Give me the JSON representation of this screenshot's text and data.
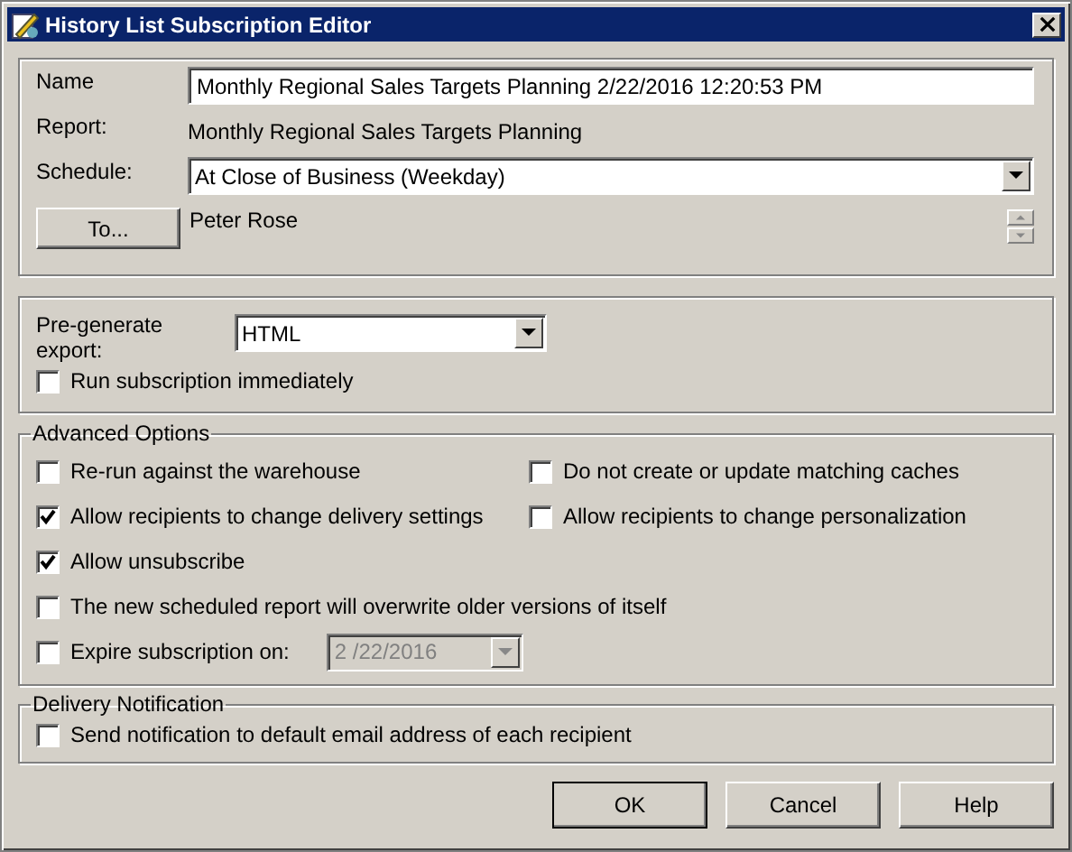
{
  "window": {
    "title": "History List Subscription Editor"
  },
  "general": {
    "name_label": "Name",
    "name_value": "Monthly Regional Sales Targets Planning 2/22/2016 12:20:53 PM",
    "report_label": "Report:",
    "report_value": "Monthly Regional Sales Targets Planning",
    "schedule_label": "Schedule:",
    "schedule_value": "At Close of Business (Weekday)",
    "to_button": "To...",
    "recipients": "Peter Rose"
  },
  "export": {
    "label": "Pre-generate export:",
    "value": "HTML",
    "run_immediately": {
      "label": "Run subscription immediately",
      "checked": false
    }
  },
  "advanced_options": {
    "title": "Advanced Options",
    "options": [
      {
        "kind": "checkbox",
        "label": "Re-run against the warehouse",
        "checked": false
      },
      {
        "kind": "checkbox",
        "label": "Do not create or update matching caches",
        "checked": false
      },
      {
        "kind": "checkbox",
        "label": "Allow recipients to change delivery settings",
        "checked": true
      },
      {
        "kind": "checkbox",
        "label": "Allow recipients to change personalization",
        "checked": false
      },
      {
        "kind": "wide",
        "label": "Allow unsubscribe",
        "checked": true
      },
      {
        "kind": "wide",
        "label": "The new scheduled report will overwrite older versions of itself",
        "checked": false
      },
      {
        "kind": "date",
        "label": "Expire subscription on:",
        "checked": false,
        "date": "2 /22/2016",
        "disabled": true
      }
    ]
  },
  "delivery_notification": {
    "title": "Delivery Notification",
    "option": {
      "label": "Send notification to default email address of each recipient",
      "checked": false
    }
  },
  "buttons": [
    "OK",
    "Cancel",
    "Help"
  ]
}
